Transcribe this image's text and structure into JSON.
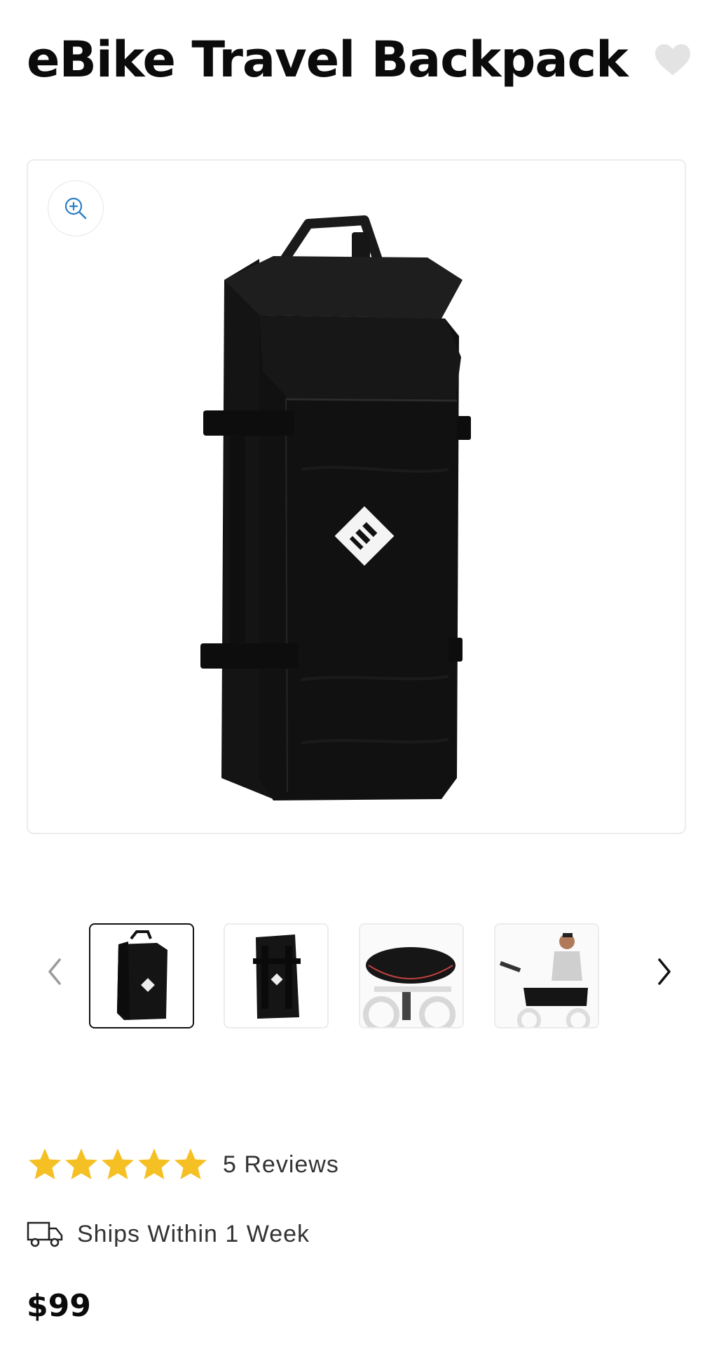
{
  "product": {
    "title": "eBike Travel Backpack",
    "price": "$99",
    "rating": 5,
    "rating_max": 5,
    "reviews_label": "5 Reviews",
    "shipping_label": "Ships Within 1 Week"
  },
  "gallery": {
    "active_index": 0,
    "thumbnails": [
      "backpack-front",
      "backpack-back",
      "bag-on-rear-rack",
      "man-loading-bag"
    ]
  },
  "icons": {
    "favorite": "heart-icon",
    "zoom": "zoom-in-icon",
    "prev": "chevron-left-icon",
    "next": "chevron-right-icon",
    "shipping": "truck-icon",
    "rating": "star-icon"
  },
  "colors": {
    "star": "#F5C024",
    "zoom_accent": "#2A7FC4",
    "heart": "#E3E3E3",
    "text": "#0B0B0B"
  }
}
